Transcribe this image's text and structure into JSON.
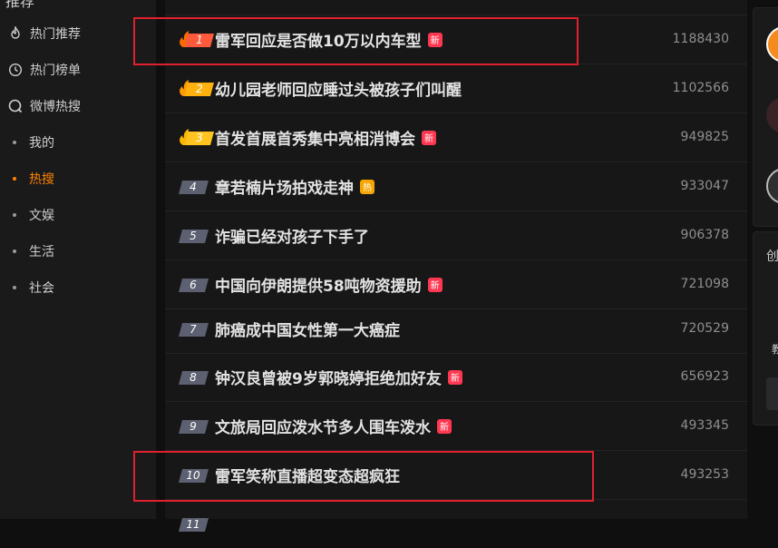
{
  "sidebar": {
    "cut_title": "推荐",
    "nav": [
      {
        "label": "热门推荐",
        "icon": "flame-icon"
      },
      {
        "label": "热门榜单",
        "icon": "clock-icon"
      },
      {
        "label": "微博热搜",
        "icon": "search-icon"
      }
    ],
    "sub": [
      {
        "label": "我的"
      },
      {
        "label": "热搜",
        "active": true
      },
      {
        "label": "文娱"
      },
      {
        "label": "生活"
      },
      {
        "label": "社会"
      }
    ]
  },
  "hot_list": [
    {
      "rank": "1",
      "title": "雷军回应是否做10万以内车型",
      "tag": "新",
      "count": "1188430"
    },
    {
      "rank": "2",
      "title": "幼儿园老师回应睡过头被孩子们叫醒",
      "tag": "",
      "count": "1102566"
    },
    {
      "rank": "3",
      "title": "首发首展首秀集中亮相消博会",
      "tag": "新",
      "count": "949825"
    },
    {
      "rank": "4",
      "title": "章若楠片场拍戏走神",
      "tag": "热",
      "count": "933047"
    },
    {
      "rank": "5",
      "title": "诈骗已经对孩子下手了",
      "tag": "",
      "count": "906378"
    },
    {
      "rank": "6",
      "title": "中国向伊朗提供58吨物资援助",
      "tag": "新",
      "count": "721098"
    },
    {
      "rank": "7",
      "title": "肺癌成中国女性第一大癌症",
      "tag": "",
      "count": "720529"
    },
    {
      "rank": "8",
      "title": "钟汉良曾被9岁郭晓婷拒绝加好友",
      "tag": "新",
      "count": "656923"
    },
    {
      "rank": "9",
      "title": "文旅局回应泼水节多人围车泼水",
      "tag": "新",
      "count": "493345"
    },
    {
      "rank": "10",
      "title": "雷军笑称直播超变态超疯狂",
      "tag": "",
      "count": "493253"
    },
    {
      "rank": "11",
      "title": "",
      "tag": "",
      "count": ""
    }
  ],
  "right": {
    "card_title_partial": "创",
    "name_partial": "教"
  },
  "colors": {
    "accent": "#ff8200",
    "highlight": "#e0202f",
    "tag_new": "#ff3852",
    "tag_hot": "#f7a500"
  }
}
